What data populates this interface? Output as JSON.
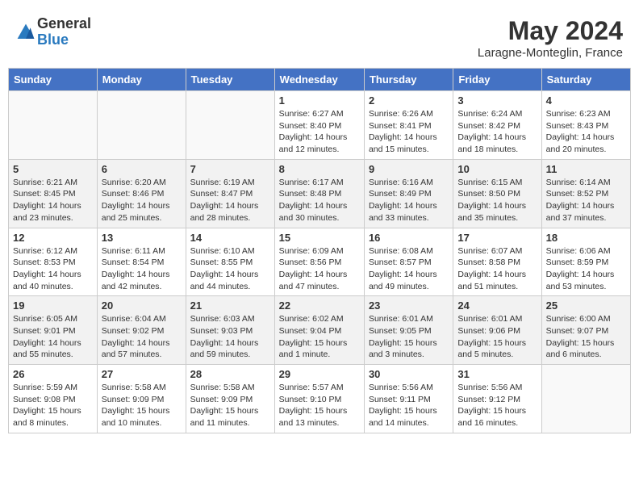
{
  "header": {
    "logo_general": "General",
    "logo_blue": "Blue",
    "month_year": "May 2024",
    "location": "Laragne-Monteglin, France"
  },
  "days_of_week": [
    "Sunday",
    "Monday",
    "Tuesday",
    "Wednesday",
    "Thursday",
    "Friday",
    "Saturday"
  ],
  "weeks": [
    [
      {
        "day": "",
        "info": ""
      },
      {
        "day": "",
        "info": ""
      },
      {
        "day": "",
        "info": ""
      },
      {
        "day": "1",
        "info": "Sunrise: 6:27 AM\nSunset: 8:40 PM\nDaylight: 14 hours and 12 minutes."
      },
      {
        "day": "2",
        "info": "Sunrise: 6:26 AM\nSunset: 8:41 PM\nDaylight: 14 hours and 15 minutes."
      },
      {
        "day": "3",
        "info": "Sunrise: 6:24 AM\nSunset: 8:42 PM\nDaylight: 14 hours and 18 minutes."
      },
      {
        "day": "4",
        "info": "Sunrise: 6:23 AM\nSunset: 8:43 PM\nDaylight: 14 hours and 20 minutes."
      }
    ],
    [
      {
        "day": "5",
        "info": "Sunrise: 6:21 AM\nSunset: 8:45 PM\nDaylight: 14 hours and 23 minutes."
      },
      {
        "day": "6",
        "info": "Sunrise: 6:20 AM\nSunset: 8:46 PM\nDaylight: 14 hours and 25 minutes."
      },
      {
        "day": "7",
        "info": "Sunrise: 6:19 AM\nSunset: 8:47 PM\nDaylight: 14 hours and 28 minutes."
      },
      {
        "day": "8",
        "info": "Sunrise: 6:17 AM\nSunset: 8:48 PM\nDaylight: 14 hours and 30 minutes."
      },
      {
        "day": "9",
        "info": "Sunrise: 6:16 AM\nSunset: 8:49 PM\nDaylight: 14 hours and 33 minutes."
      },
      {
        "day": "10",
        "info": "Sunrise: 6:15 AM\nSunset: 8:50 PM\nDaylight: 14 hours and 35 minutes."
      },
      {
        "day": "11",
        "info": "Sunrise: 6:14 AM\nSunset: 8:52 PM\nDaylight: 14 hours and 37 minutes."
      }
    ],
    [
      {
        "day": "12",
        "info": "Sunrise: 6:12 AM\nSunset: 8:53 PM\nDaylight: 14 hours and 40 minutes."
      },
      {
        "day": "13",
        "info": "Sunrise: 6:11 AM\nSunset: 8:54 PM\nDaylight: 14 hours and 42 minutes."
      },
      {
        "day": "14",
        "info": "Sunrise: 6:10 AM\nSunset: 8:55 PM\nDaylight: 14 hours and 44 minutes."
      },
      {
        "day": "15",
        "info": "Sunrise: 6:09 AM\nSunset: 8:56 PM\nDaylight: 14 hours and 47 minutes."
      },
      {
        "day": "16",
        "info": "Sunrise: 6:08 AM\nSunset: 8:57 PM\nDaylight: 14 hours and 49 minutes."
      },
      {
        "day": "17",
        "info": "Sunrise: 6:07 AM\nSunset: 8:58 PM\nDaylight: 14 hours and 51 minutes."
      },
      {
        "day": "18",
        "info": "Sunrise: 6:06 AM\nSunset: 8:59 PM\nDaylight: 14 hours and 53 minutes."
      }
    ],
    [
      {
        "day": "19",
        "info": "Sunrise: 6:05 AM\nSunset: 9:01 PM\nDaylight: 14 hours and 55 minutes."
      },
      {
        "day": "20",
        "info": "Sunrise: 6:04 AM\nSunset: 9:02 PM\nDaylight: 14 hours and 57 minutes."
      },
      {
        "day": "21",
        "info": "Sunrise: 6:03 AM\nSunset: 9:03 PM\nDaylight: 14 hours and 59 minutes."
      },
      {
        "day": "22",
        "info": "Sunrise: 6:02 AM\nSunset: 9:04 PM\nDaylight: 15 hours and 1 minute."
      },
      {
        "day": "23",
        "info": "Sunrise: 6:01 AM\nSunset: 9:05 PM\nDaylight: 15 hours and 3 minutes."
      },
      {
        "day": "24",
        "info": "Sunrise: 6:01 AM\nSunset: 9:06 PM\nDaylight: 15 hours and 5 minutes."
      },
      {
        "day": "25",
        "info": "Sunrise: 6:00 AM\nSunset: 9:07 PM\nDaylight: 15 hours and 6 minutes."
      }
    ],
    [
      {
        "day": "26",
        "info": "Sunrise: 5:59 AM\nSunset: 9:08 PM\nDaylight: 15 hours and 8 minutes."
      },
      {
        "day": "27",
        "info": "Sunrise: 5:58 AM\nSunset: 9:09 PM\nDaylight: 15 hours and 10 minutes."
      },
      {
        "day": "28",
        "info": "Sunrise: 5:58 AM\nSunset: 9:09 PM\nDaylight: 15 hours and 11 minutes."
      },
      {
        "day": "29",
        "info": "Sunrise: 5:57 AM\nSunset: 9:10 PM\nDaylight: 15 hours and 13 minutes."
      },
      {
        "day": "30",
        "info": "Sunrise: 5:56 AM\nSunset: 9:11 PM\nDaylight: 15 hours and 14 minutes."
      },
      {
        "day": "31",
        "info": "Sunrise: 5:56 AM\nSunset: 9:12 PM\nDaylight: 15 hours and 16 minutes."
      },
      {
        "day": "",
        "info": ""
      }
    ]
  ]
}
